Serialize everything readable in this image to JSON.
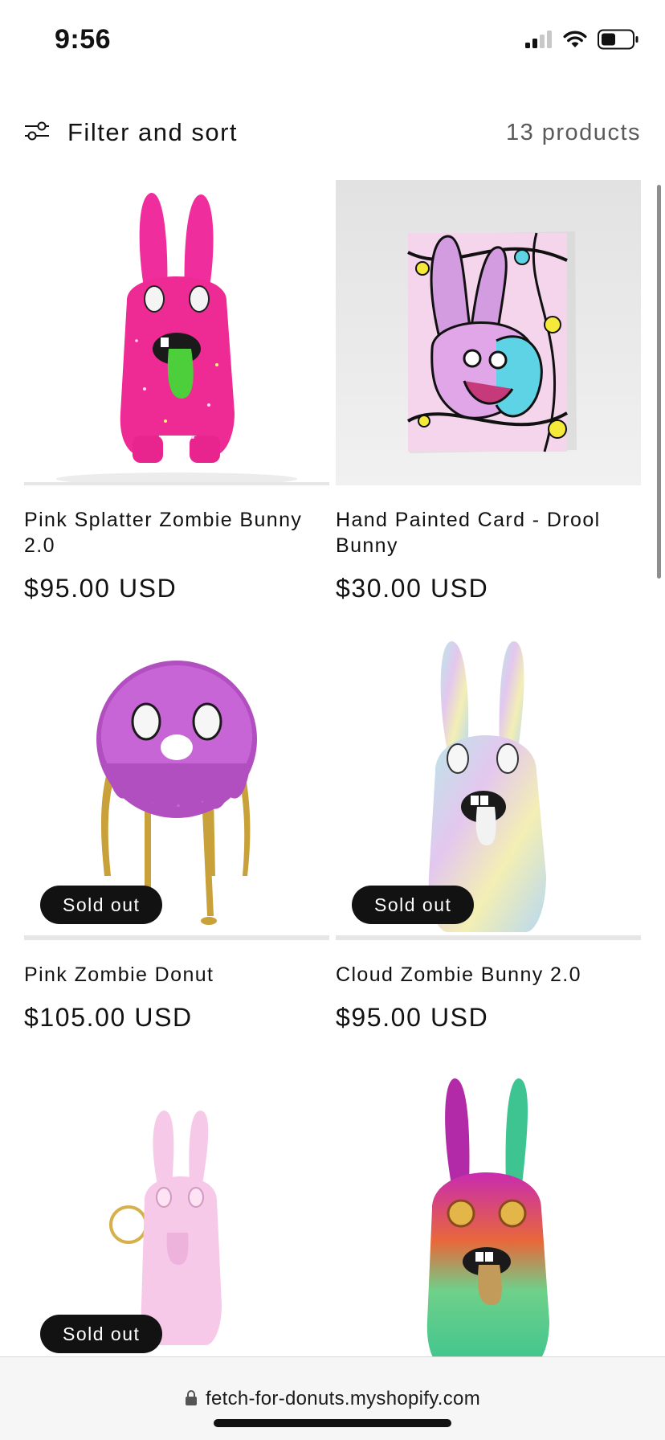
{
  "status_bar": {
    "time": "9:56",
    "icons": [
      "cellular-signal-icon",
      "wifi-icon",
      "battery-icon"
    ]
  },
  "toolbar": {
    "filter_label": "Filter and sort",
    "filter_icon": "sliders-icon",
    "product_count": "13 products"
  },
  "products": [
    {
      "title": "Pink Splatter Zombie Bunny 2.0",
      "price": "$95.00 USD",
      "badge": null,
      "image": "pink-splatter-bunny-figure"
    },
    {
      "title": "Hand Painted Card - Drool Bunny",
      "price": "$30.00 USD",
      "badge": null,
      "image": "drool-bunny-card"
    },
    {
      "title": "Pink Zombie Donut",
      "price": "$105.00 USD",
      "badge": "Sold out",
      "image": "pink-zombie-donut-figure"
    },
    {
      "title": "Cloud Zombie Bunny 2.0",
      "price": "$95.00 USD",
      "badge": "Sold out",
      "image": "cloud-zombie-bunny-figure"
    },
    {
      "title": "",
      "price": "",
      "badge": "Sold out",
      "image": "pink-keychain-bunny"
    },
    {
      "title": "",
      "price": "",
      "badge": null,
      "image": "rainbow-zombie-bunny-figure"
    }
  ],
  "browser": {
    "url": "fetch-for-donuts.myshopify.com",
    "lock_icon": "lock-icon"
  },
  "colors": {
    "text": "#121212",
    "badge_bg": "#121212",
    "badge_text": "#ffffff",
    "muted": "#5a5a5a"
  }
}
